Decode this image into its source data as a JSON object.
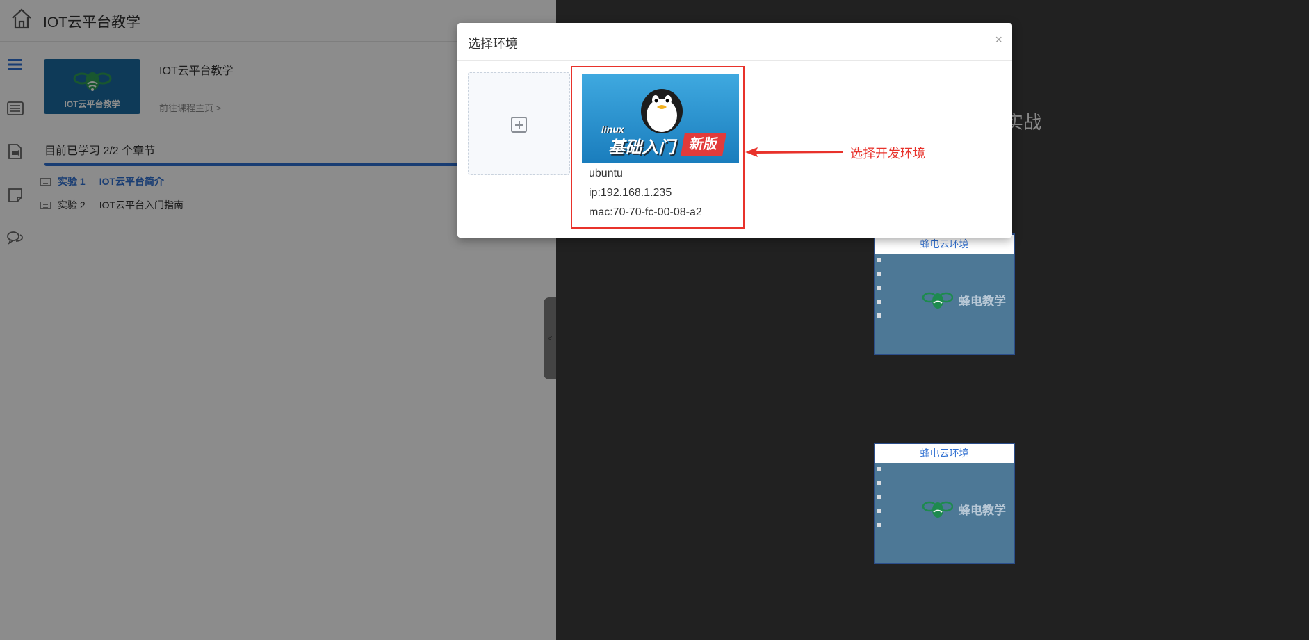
{
  "app": {
    "title": "IOT云平台教学"
  },
  "course": {
    "thumb_label": "IOT云平台教学",
    "title": "IOT云平台教学",
    "link_label": "前往课程主页 >"
  },
  "progress": {
    "text": "目前已学习 2/2 个章节",
    "fraction": 1.0
  },
  "lessons": [
    {
      "num": "实验 1",
      "title": "IOT云平台简介",
      "active": true
    },
    {
      "num": "实验 2",
      "title": "IOT云平台入门指南",
      "active": false
    }
  ],
  "right": {
    "heading": "启实战",
    "env_cards": [
      {
        "title": "蜂电云环境",
        "brand": "蜂电教学"
      },
      {
        "title": "蜂电云环境",
        "brand": "蜂电教学"
      }
    ]
  },
  "modal": {
    "title": "选择环境",
    "close": "×",
    "option": {
      "image_linux": "linux",
      "image_cn": "基础入门",
      "image_badge": "新版",
      "name": "ubuntu",
      "ip": "ip:192.168.1.235",
      "mac": "mac:70-70-fc-00-08-a2"
    }
  },
  "annotation": {
    "text": "选择开发环境"
  },
  "colors": {
    "accent": "#2f6fd1",
    "annotation": "#e8322b",
    "dark_bg": "#212121"
  },
  "icons": {
    "home": "home-icon",
    "sidebar": [
      "menu-icon",
      "list-icon",
      "video-icon",
      "note-icon",
      "chat-icon"
    ],
    "add": "plus-square-icon"
  }
}
